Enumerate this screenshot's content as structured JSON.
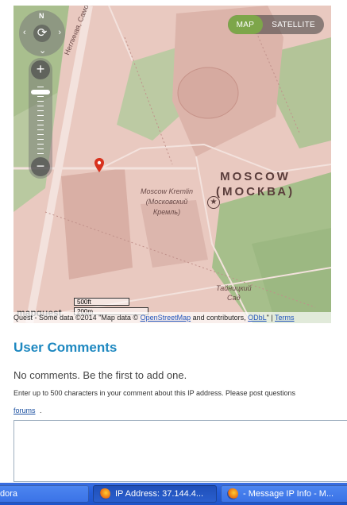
{
  "map": {
    "toggle": {
      "map": "MAP",
      "satellite": "SATELLITE"
    },
    "compass": {
      "north": "N"
    },
    "zoom": {
      "in": "+",
      "out": "−"
    },
    "labels": {
      "city_line1": "MOSCOW",
      "city_line2": "(МОСКВА)",
      "kremlin_line1": "Moscow Kremlin",
      "kremlin_line2": "(Московский",
      "kremlin_line3": "Кремль)",
      "garden_line1": "Тайницкий",
      "garden_line2": "Сад",
      "street": "Неглиная, Самотёка"
    },
    "scale": {
      "top": "500ft",
      "bottom": "200m"
    },
    "logo": "mapquest",
    "attribution": {
      "prefix": "Quest - Some data ©2014 \"Map data ©",
      "osm_link": "OpenStreetMap",
      "middle": " and contributors, ",
      "odbl_link": "ODbL",
      "suffix": "\" | ",
      "terms_link": "Terms"
    }
  },
  "comments": {
    "heading": "User Comments",
    "empty_message": "No comments. Be the first to add one.",
    "instructions": "Enter up to 500 characters in your comment about this IP address. Please post questions",
    "forums_link": "forums",
    "forums_suffix": ".",
    "textarea_value": ""
  },
  "taskbar": {
    "items": [
      {
        "label": "dora"
      },
      {
        "label": "IP Address: 37.144.4..."
      },
      {
        "label": "- Message IP Info - M..."
      }
    ]
  }
}
